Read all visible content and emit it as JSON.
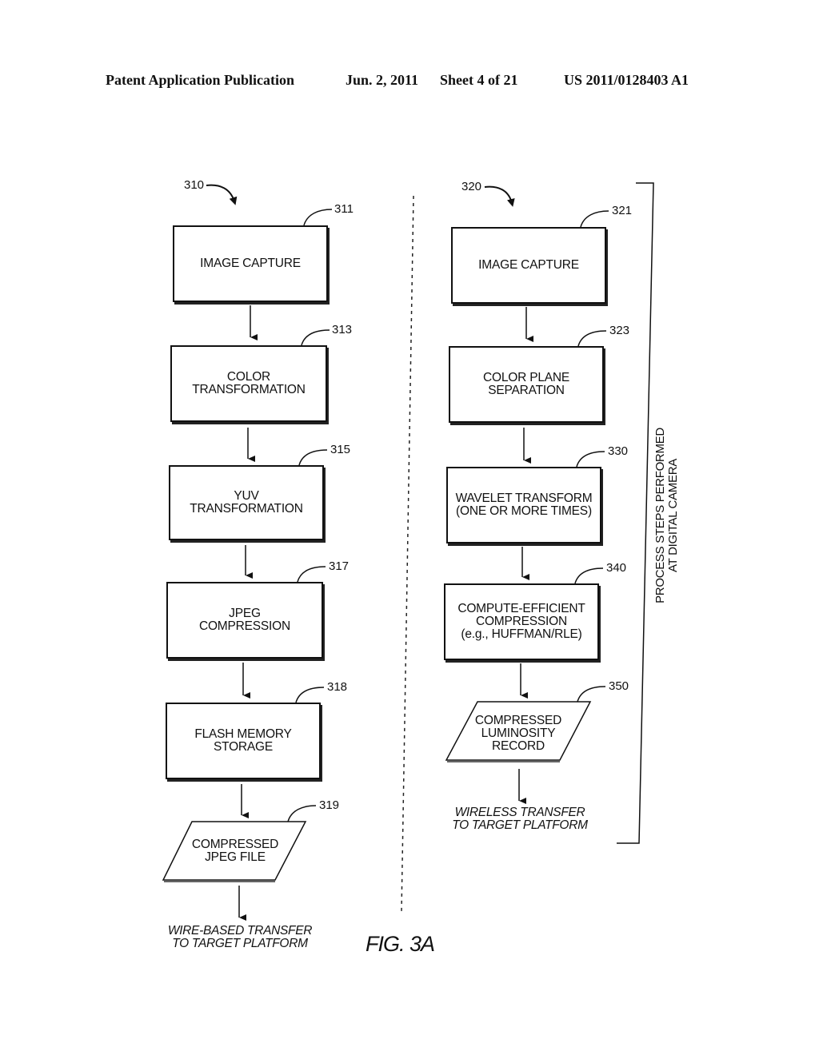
{
  "header": {
    "publication": "Patent Application Publication",
    "date": "Jun. 2, 2011",
    "sheet": "Sheet 4 of 21",
    "number": "US 2011/0128403 A1"
  },
  "left_flow": {
    "ref": "310",
    "steps": [
      {
        "ref": "311",
        "label": "IMAGE CAPTURE",
        "shape": "process"
      },
      {
        "ref": "313",
        "label": "COLOR\nTRANSFORMATION",
        "shape": "process"
      },
      {
        "ref": "315",
        "label": "YUV\nTRANSFORMATION",
        "shape": "process"
      },
      {
        "ref": "317",
        "label": "JPEG\nCOMPRESSION",
        "shape": "process"
      },
      {
        "ref": "318",
        "label": "FLASH MEMORY\nSTORAGE",
        "shape": "process"
      },
      {
        "ref": "319",
        "label": "COMPRESSED\nJPEG FILE",
        "shape": "data"
      }
    ],
    "output": "WIRE-BASED TRANSFER\nTO TARGET PLATFORM"
  },
  "right_flow": {
    "ref": "320",
    "steps": [
      {
        "ref": "321",
        "label": "IMAGE CAPTURE",
        "shape": "process"
      },
      {
        "ref": "323",
        "label": "COLOR PLANE\nSEPARATION",
        "shape": "process"
      },
      {
        "ref": "330",
        "label": "WAVELET TRANSFORM\n(ONE OR MORE TIMES)",
        "shape": "process"
      },
      {
        "ref": "340",
        "label": "COMPUTE-EFFICIENT\nCOMPRESSION\n(e.g., HUFFMAN/RLE)",
        "shape": "process"
      },
      {
        "ref": "350",
        "label": "COMPRESSED\nLUMINOSITY\nRECORD",
        "shape": "data"
      }
    ],
    "output": "WIRELESS TRANSFER\nTO TARGET PLATFORM"
  },
  "bracket_label": "PROCESS STEPS PERFORMED\nAT DIGITAL CAMERA",
  "figure_label": "FIG. 3A"
}
